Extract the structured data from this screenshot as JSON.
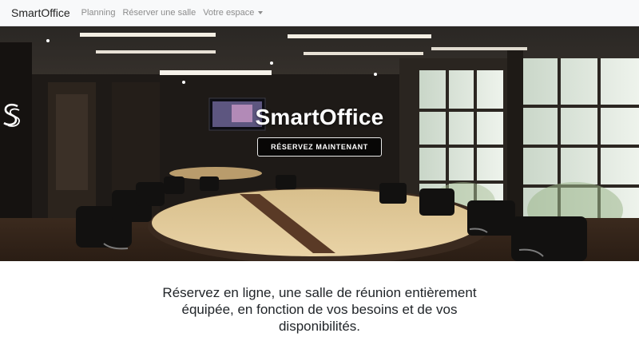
{
  "navbar": {
    "brand": "SmartOffice",
    "links": [
      "Planning",
      "Réserver une salle"
    ],
    "dropdown": "Votre espace"
  },
  "hero": {
    "logo_icon": "smartoffice-s-logo-icon",
    "title": "SmartOffice",
    "cta_label": "RÉSERVEZ MAINTENANT"
  },
  "intro": {
    "lines": [
      "Réservez en ligne, une salle de réunion entièrement",
      "équipée, en fonction de vos besoins et de vos",
      "disponibilités."
    ]
  },
  "colors": {
    "navbar_bg": "#f8f9fa",
    "brand_text": "#222222",
    "nav_link": "#8c8c8c",
    "cta_border": "#e8e8e8",
    "body_text": "#212529"
  }
}
